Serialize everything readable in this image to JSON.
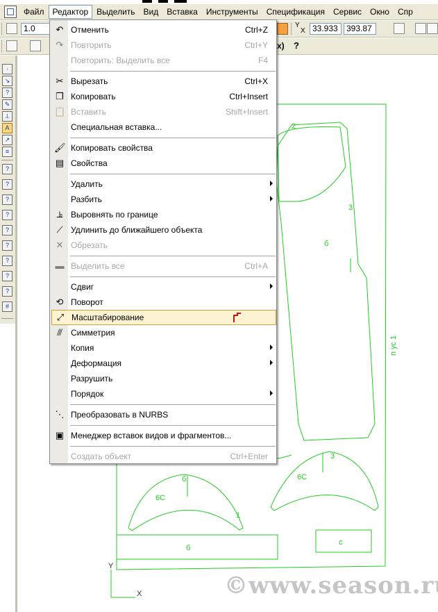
{
  "menubar": {
    "items": [
      {
        "id": "file",
        "label": "Файл"
      },
      {
        "id": "edit",
        "label": "Редактор"
      },
      {
        "id": "select",
        "label": "Выделить"
      },
      {
        "id": "view",
        "label": "Вид"
      },
      {
        "id": "insert",
        "label": "Вставка"
      },
      {
        "id": "tools",
        "label": "Инструменты"
      },
      {
        "id": "spec",
        "label": "Спецификация"
      },
      {
        "id": "service",
        "label": "Сервис"
      },
      {
        "id": "window",
        "label": "Окно"
      },
      {
        "id": "help",
        "label": "Спр"
      }
    ]
  },
  "toolbar": {
    "scale_value": "1.0",
    "coord_x": "33.933",
    "coord_y": "393.87",
    "coord_x_label": "X",
    "coord_y_label": "Y",
    "bracket_text": "x)",
    "help_mark": "?"
  },
  "edit_menu": {
    "items": [
      {
        "label": "Отменить",
        "shortcut": "Ctrl+Z",
        "icon": "undo-icon",
        "glyph": "↶",
        "disabled": false
      },
      {
        "label": "Повторить",
        "shortcut": "Ctrl+Y",
        "icon": "redo-icon",
        "glyph": "↷",
        "disabled": true
      },
      {
        "label": "Повторить: Выделить все",
        "shortcut": "F4",
        "icon": "",
        "glyph": "",
        "disabled": true
      },
      {
        "sep": true
      },
      {
        "label": "Вырезать",
        "shortcut": "Ctrl+X",
        "icon": "scissors-icon",
        "glyph": "✂",
        "disabled": false
      },
      {
        "label": "Копировать",
        "shortcut": "Ctrl+Insert",
        "icon": "copy-icon",
        "glyph": "❐",
        "disabled": false
      },
      {
        "label": "Вставить",
        "shortcut": "Shift+Insert",
        "icon": "paste-icon",
        "glyph": "📋",
        "disabled": true
      },
      {
        "label": "Специальная вставка...",
        "shortcut": "",
        "icon": "",
        "glyph": "",
        "disabled": false
      },
      {
        "sep": true
      },
      {
        "label": "Копировать свойства",
        "shortcut": "",
        "icon": "brush-icon",
        "glyph": "🖌",
        "disabled": false
      },
      {
        "label": "Свойства",
        "shortcut": "",
        "icon": "properties-icon",
        "glyph": "▤",
        "disabled": false
      },
      {
        "sep": true
      },
      {
        "label": "Удалить",
        "shortcut": "",
        "icon": "",
        "glyph": "",
        "disabled": false,
        "submenu": true
      },
      {
        "label": "Разбить",
        "shortcut": "",
        "icon": "",
        "glyph": "",
        "disabled": false,
        "submenu": true
      },
      {
        "label": "Выровнять по границе",
        "shortcut": "",
        "icon": "align-boundary-icon",
        "glyph": "⫡",
        "disabled": false
      },
      {
        "label": "Удлинить до ближайшего объекта",
        "shortcut": "",
        "icon": "extend-icon",
        "glyph": "⟋",
        "disabled": false
      },
      {
        "label": "Обрезать",
        "shortcut": "",
        "icon": "trim-icon",
        "glyph": "✕",
        "disabled": true
      },
      {
        "sep": true
      },
      {
        "label": "Выделить все",
        "shortcut": "Ctrl+A",
        "icon": "select-all-icon",
        "glyph": "▬",
        "disabled": true
      },
      {
        "sep": true
      },
      {
        "label": "Сдвиг",
        "shortcut": "",
        "icon": "",
        "glyph": "",
        "disabled": false,
        "submenu": true
      },
      {
        "label": "Поворот",
        "shortcut": "",
        "icon": "rotate-icon",
        "glyph": "⟲",
        "disabled": false
      },
      {
        "label": "Масштабирование",
        "shortcut": "",
        "icon": "scale-icon",
        "glyph": "⤢",
        "disabled": false,
        "highlighted": true
      },
      {
        "label": "Симметрия",
        "shortcut": "",
        "icon": "mirror-icon",
        "glyph": "⫻",
        "disabled": false
      },
      {
        "label": "Копия",
        "shortcut": "",
        "icon": "",
        "glyph": "",
        "disabled": false,
        "submenu": true
      },
      {
        "label": "Деформация",
        "shortcut": "",
        "icon": "",
        "glyph": "",
        "disabled": false,
        "submenu": true
      },
      {
        "label": "Разрушить",
        "shortcut": "",
        "icon": "",
        "glyph": "",
        "disabled": false
      },
      {
        "label": "Порядок",
        "shortcut": "",
        "icon": "",
        "glyph": "",
        "disabled": false,
        "submenu": true
      },
      {
        "sep": true
      },
      {
        "label": "Преобразовать в NURBS",
        "shortcut": "",
        "icon": "nurbs-icon",
        "glyph": "⋱",
        "disabled": false
      },
      {
        "sep": true
      },
      {
        "label": "Менеджер вставок видов и фрагментов...",
        "shortcut": "",
        "icon": "insert-manager-icon",
        "glyph": "▣",
        "disabled": false
      },
      {
        "sep": true
      },
      {
        "label": "Создать объект",
        "shortcut": "Ctrl+Enter",
        "icon": "",
        "glyph": "",
        "disabled": true
      }
    ]
  },
  "drawing": {
    "labels": {
      "a": "2",
      "b": "3",
      "c": "б",
      "d": "1",
      "e": "б",
      "f": "3",
      "g": "6С",
      "h": "6С",
      "i": "б",
      "j": "с",
      "k": "п ус 1",
      "axis_x": "X",
      "axis_y": "Y"
    },
    "line_color": "#22cc22"
  },
  "watermark": "©www.season.ru"
}
